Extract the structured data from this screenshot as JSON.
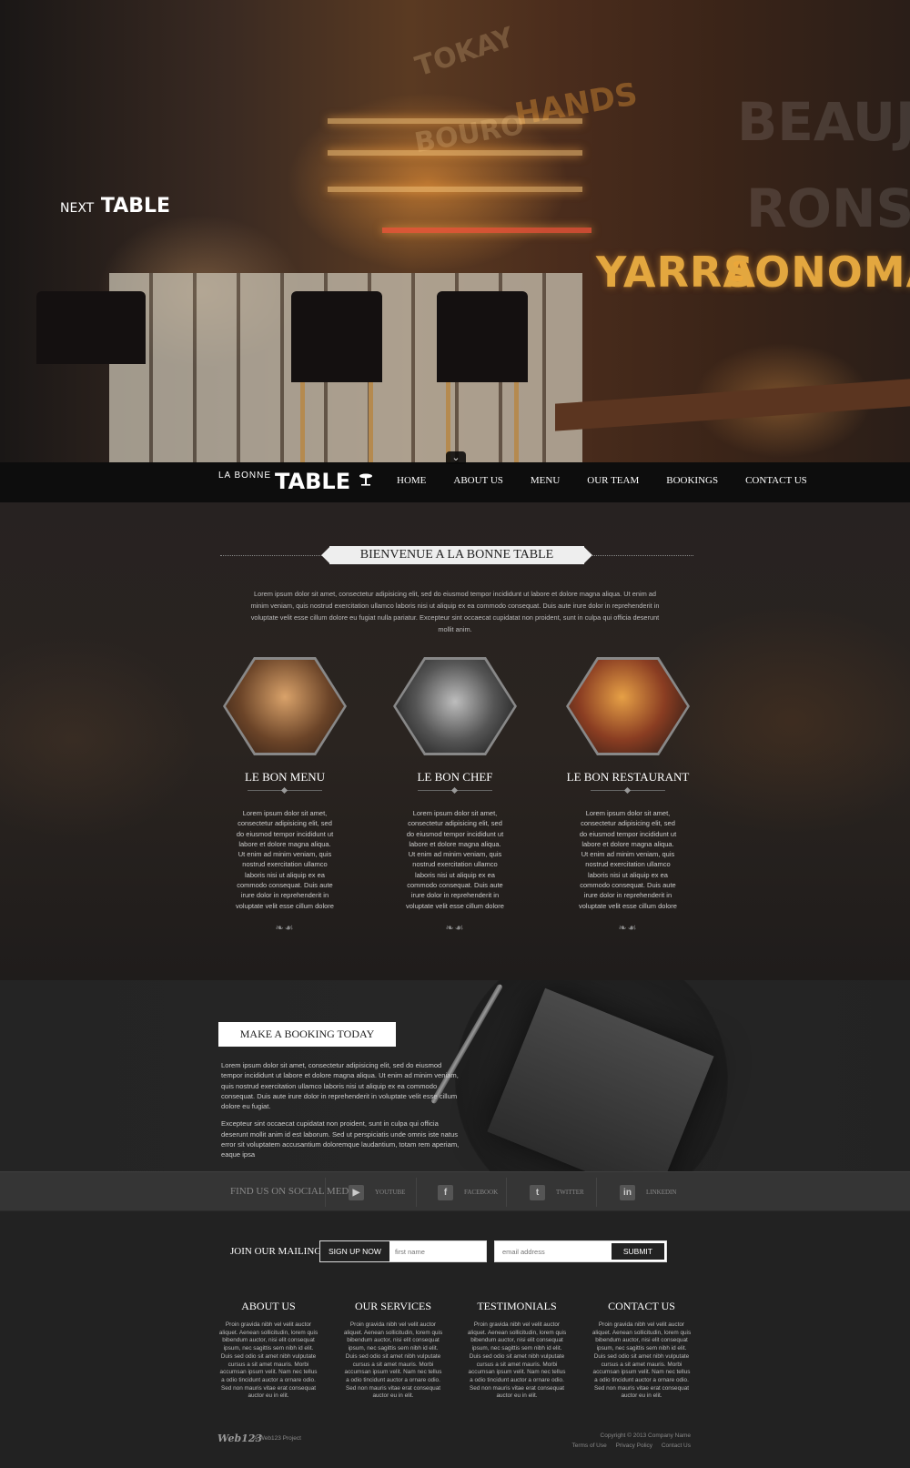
{
  "hero": {
    "sign_next": "NEXT",
    "sign_table": "TABLE",
    "wall_word_1": "YARRA",
    "wall_word_2": "SONOMA",
    "faint_1": "BEAUJOL",
    "faint_2": "RONSA",
    "faint_3": "TOKAY",
    "faint_4": "HANDS",
    "faint_5": "BOURO"
  },
  "nav": {
    "logo_small": "LA BONNE",
    "logo_big": "TABLE",
    "items": [
      "Home",
      "About Us",
      "Menu",
      "Our Team",
      "Bookings",
      "Contact Us"
    ]
  },
  "welcome": {
    "title": "Bienvenue a la Bonne Table",
    "intro": "Lorem ipsum dolor sit amet, consectetur adipisicing elit, sed do eiusmod tempor incididunt ut labore et dolore magna aliqua. Ut enim ad minim veniam, quis nostrud exercitation ullamco laboris nisi ut aliquip ex ea commodo consequat. Duis aute irure dolor in reprehenderit in voluptate velit esse cillum dolore eu fugiat nulla pariatur. Excepteur sint occaecat cupidatat non proident, sunt in culpa qui officia deserunt mollit anim.",
    "features": [
      {
        "title": "Le Bon Menu",
        "text": "Lorem ipsum dolor sit amet, consectetur adipisicing elit, sed do eiusmod tempor incididunt ut labore et dolore magna aliqua. Ut enim ad minim veniam, quis nostrud exercitation ullamco laboris nisi ut aliquip ex ea commodo consequat. Duis aute irure dolor in reprehenderit in voluptate velit esse cillum dolore"
      },
      {
        "title": "Le Bon Chef",
        "text": "Lorem ipsum dolor sit amet, consectetur adipisicing elit, sed do eiusmod tempor incididunt ut labore et dolore magna aliqua. Ut enim ad minim veniam, quis nostrud exercitation ullamco laboris nisi ut aliquip ex ea commodo consequat. Duis aute irure dolor in reprehenderit in voluptate velit esse cillum dolore"
      },
      {
        "title": "Le Bon Restaurant",
        "text": "Lorem ipsum dolor sit amet, consectetur adipisicing elit, sed do eiusmod tempor incididunt ut labore et dolore magna aliqua. Ut enim ad minim veniam, quis nostrud exercitation ullamco laboris nisi ut aliquip ex ea commodo consequat. Duis aute irure dolor in reprehenderit in voluptate velit esse cillum dolore"
      }
    ]
  },
  "booking": {
    "title": "Make a Booking Today",
    "para1": "Lorem ipsum dolor sit amet, consectetur adipisicing elit, sed do eiusmod tempor incididunt ut labore et dolore magna aliqua. Ut enim ad minim veniam, quis nostrud exercitation ullamco laboris nisi ut aliquip ex ea commodo consequat. Duis aute irure dolor in reprehenderit in voluptate velit esse cillum dolore eu fugiat.",
    "para2": "Excepteur sint occaecat cupidatat non proident, sunt in culpa qui officia deserunt mollit anim id est laborum. Sed ut perspiciatis unde omnis iste natus error sit voluptatem accusantium doloremque laudantium, totam rem aperiam, eaque ipsa"
  },
  "social": {
    "label": "Find us on social media",
    "items": [
      {
        "icon": "youtube-icon",
        "glyph": "▶",
        "label": "Youtube"
      },
      {
        "icon": "facebook-icon",
        "glyph": "f",
        "label": "Facebook"
      },
      {
        "icon": "twitter-icon",
        "glyph": "t",
        "label": "Twitter"
      },
      {
        "icon": "linkedin-icon",
        "glyph": "in",
        "label": "LinkedIn"
      }
    ]
  },
  "mailing": {
    "label": "Join our mailing list",
    "signup_label": "Sign up now",
    "first_name_placeholder": "first name",
    "email_placeholder": "email address",
    "submit_label": "Submit"
  },
  "footer_columns": [
    {
      "title": "About Us",
      "text": "Proin gravida nibh vel velit auctor aliquet. Aenean sollicitudin, lorem quis bibendum auctor, nisi elit consequat ipsum, nec sagittis sem nibh id elit. Duis sed odio sit amet nibh vulputate cursus a sit amet mauris. Morbi accumsan ipsum velit. Nam nec tellus a odio tincidunt auctor a ornare odio. Sed non mauris vitae erat consequat auctor eu in elit."
    },
    {
      "title": "Our Services",
      "text": "Proin gravida nibh vel velit auctor aliquet. Aenean sollicitudin, lorem quis bibendum auctor, nisi elit consequat ipsum, nec sagittis sem nibh id elit. Duis sed odio sit amet nibh vulputate cursus a sit amet mauris. Morbi accumsan ipsum velit. Nam nec tellus a odio tincidunt auctor a ornare odio. Sed non mauris vitae erat consequat auctor eu in elit."
    },
    {
      "title": "Testimonials",
      "text": "Proin gravida nibh vel velit auctor aliquet. Aenean sollicitudin, lorem quis bibendum auctor, nisi elit consequat ipsum, nec sagittis sem nibh id elit. Duis sed odio sit amet nibh vulputate cursus a sit amet mauris. Morbi accumsan ipsum velit. Nam nec tellus a odio tincidunt auctor a ornare odio. Sed non mauris vitae erat consequat auctor eu in elit."
    },
    {
      "title": "Contact Us",
      "text": "Proin gravida nibh vel velit auctor aliquet. Aenean sollicitudin, lorem quis bibendum auctor, nisi elit consequat ipsum, nec sagittis sem nibh id elit. Duis sed odio sit amet nibh vulputate cursus a sit amet mauris. Morbi accumsan ipsum velit. Nam nec tellus a odio tincidunt auctor a ornare odio. Sed non mauris vitae erat consequat auctor eu in elit."
    }
  ],
  "bottom": {
    "brand": "Web123",
    "brand_sub": "A Web123 Project",
    "copyright": "Copyright © 2013 Company Name",
    "links": [
      "Terms of Use",
      "Privacy Policy",
      "Contact Us"
    ]
  },
  "colors": {
    "accent_gold": "#e3a73f",
    "dark_bg": "#222222",
    "nav_bg": "#0a0a0a"
  }
}
